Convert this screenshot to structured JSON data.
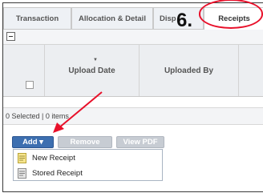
{
  "tabs": [
    {
      "label": "Transaction"
    },
    {
      "label": "Allocation & Detail"
    },
    {
      "label": "Disp"
    },
    {
      "label": "Receipts",
      "active": true
    }
  ],
  "annotation": {
    "step": "6.",
    "color": "#e8102a"
  },
  "grid": {
    "columns": [
      {
        "label": ""
      },
      {
        "label": "Upload Date",
        "sorted": "desc"
      },
      {
        "label": "Uploaded By"
      },
      {
        "label": ""
      }
    ]
  },
  "status": {
    "text": "0 Selected | 0 items"
  },
  "toolbar": {
    "add_label": "Add ▾",
    "remove_label": "Remove",
    "view_pdf_label": "View PDF"
  },
  "add_menu": {
    "items": [
      {
        "label": "New Receipt",
        "icon": "receipt-icon"
      },
      {
        "label": "Stored Receipt",
        "icon": "stored-receipt-icon"
      }
    ]
  },
  "colors": {
    "accent": "#3d6fb0",
    "disabled": "#c7ccd3",
    "annotation": "#e8102a"
  }
}
